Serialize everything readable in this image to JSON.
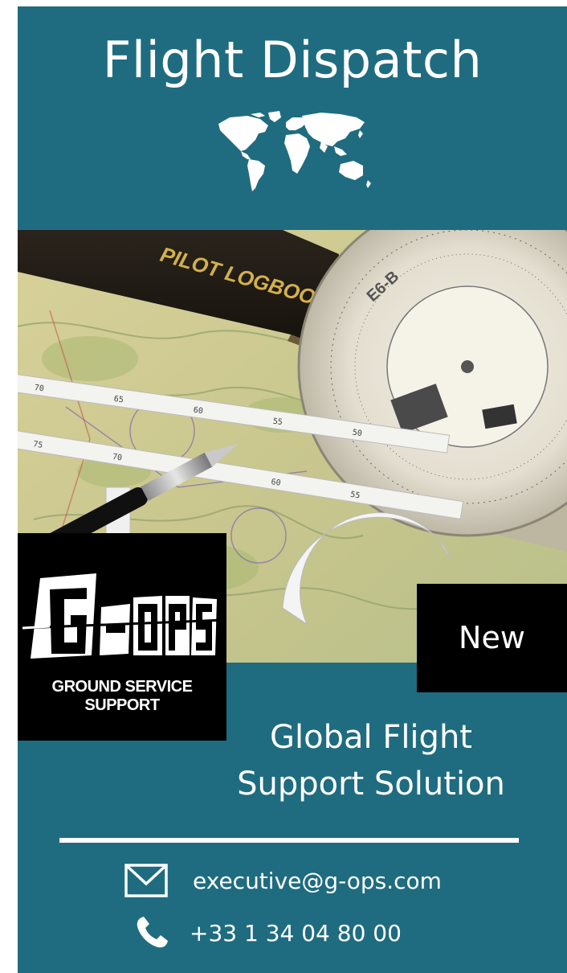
{
  "header": {
    "title": "Flight Dispatch",
    "globe_icon": "world-map-icon"
  },
  "photo": {
    "logbook_label": "PILOT LOGBOOK",
    "computer_label": "E6-B"
  },
  "logo": {
    "mark": "G-OPS",
    "subtitle": "GROUND SERVICE SUPPORT"
  },
  "badge": {
    "label": "New"
  },
  "tagline": {
    "line1": "Global Flight",
    "line2": "Support Solution"
  },
  "contact": {
    "email": "executive@g-ops.com",
    "email_icon": "envelope-icon",
    "phone": "+33 1 34 04 80 00",
    "phone_icon": "phone-icon"
  },
  "colors": {
    "background": "#1f6c80",
    "box": "#000000",
    "text": "#ffffff"
  }
}
